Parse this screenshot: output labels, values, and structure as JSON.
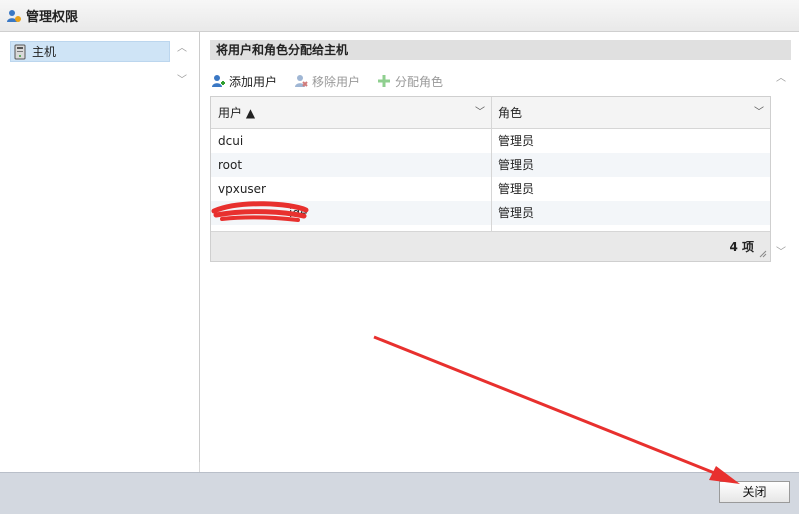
{
  "window": {
    "title": "管理权限"
  },
  "sidebar": {
    "items": [
      {
        "label": "主机",
        "icon": "host-icon"
      }
    ]
  },
  "section": {
    "title": "将用户和角色分配给主机"
  },
  "toolbar": {
    "add_user": "添加用户",
    "remove_user": "移除用户",
    "assign_role": "分配角色"
  },
  "table": {
    "columns": [
      "用户 ▲",
      "角色"
    ],
    "rows": [
      {
        "user": "dcui",
        "role": "管理员"
      },
      {
        "user": "root",
        "role": "管理员"
      },
      {
        "user": "vpxuser",
        "role": "管理员"
      },
      {
        "user": "ide",
        "role": "管理员"
      }
    ],
    "count_label": "4 项"
  },
  "footer": {
    "close_label": "关闭"
  },
  "colors": {
    "selection": "#cfe4f6",
    "annotation": "#e8302e",
    "footer_bg": "#d3d8e0"
  }
}
